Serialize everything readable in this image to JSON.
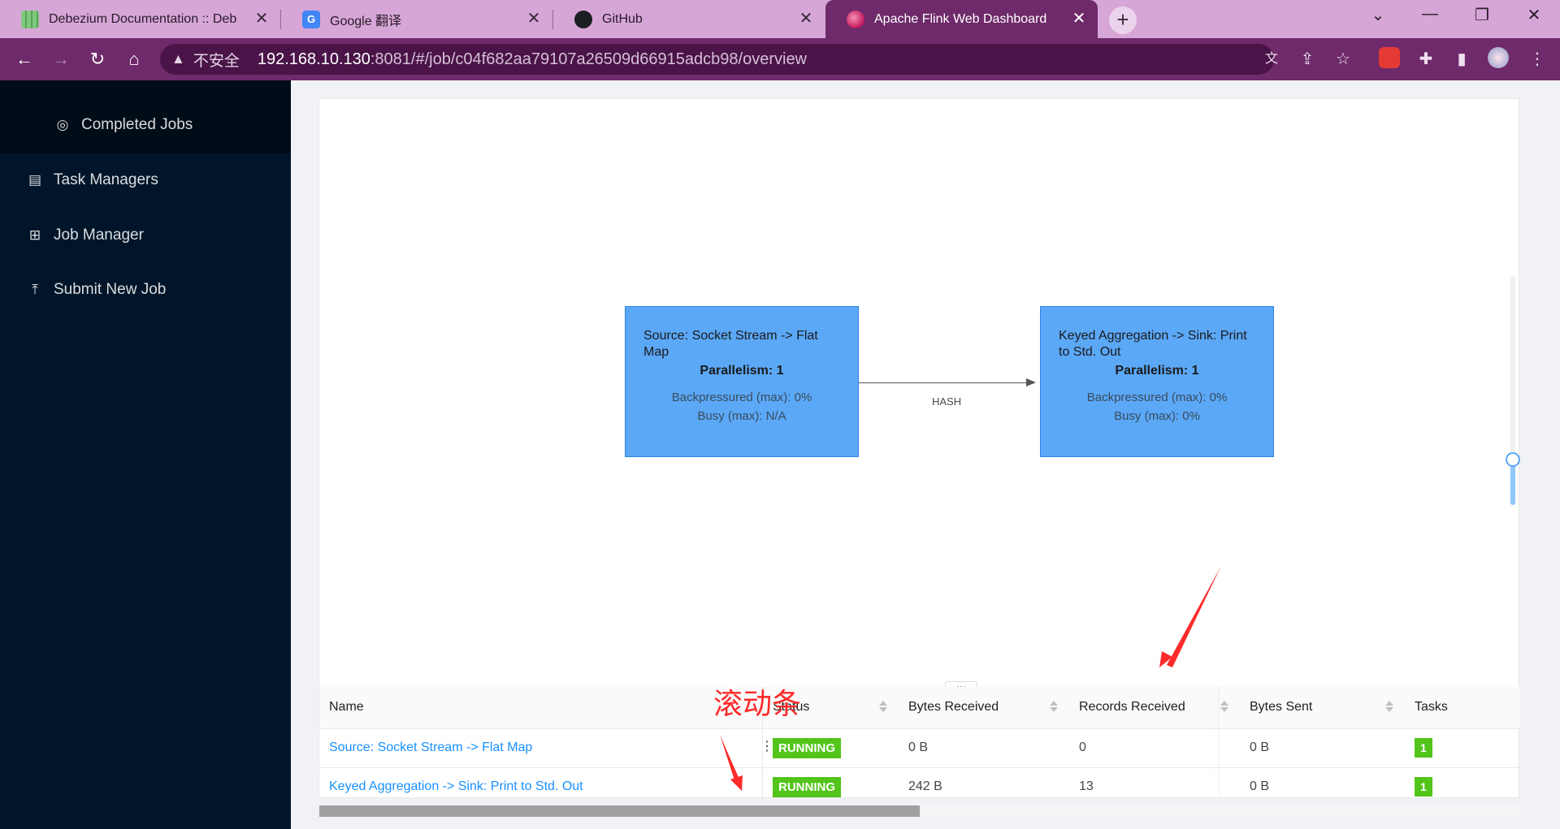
{
  "browser": {
    "tabs": [
      {
        "label": "Debezium Documentation :: Deb",
        "icon": "debezium-favicon",
        "active": false
      },
      {
        "label": "Google 翻译",
        "icon": "google-translate-favicon",
        "active": false
      },
      {
        "label": "GitHub",
        "icon": "github-favicon",
        "active": false
      },
      {
        "label": "Apache Flink Web Dashboard",
        "icon": "flink-favicon",
        "active": true
      }
    ],
    "close_glyph": "✕",
    "new_tab_glyph": "+",
    "insecure_label": "不安全",
    "url_host": "192.168.10.130",
    "url_path": ":8081/#/job/c04f682aa79107a26509d66915adcb98/overview",
    "colors": {
      "tabbar": "#d6a6d6",
      "toolbar": "#6e2a6a"
    }
  },
  "sidebar": {
    "completed_jobs": "Completed Jobs",
    "task_managers": "Task Managers",
    "job_manager": "Job Manager",
    "submit_new_job": "Submit New Job"
  },
  "graph": {
    "nodes": [
      {
        "title": "Source: Socket Stream -> Flat Map",
        "parallelism": "Parallelism: 1",
        "backpressured": "Backpressured (max): 0%",
        "busy": "Busy (max): N/A"
      },
      {
        "title": "Keyed Aggregation -> Sink: Print to Std. Out",
        "parallelism": "Parallelism: 1",
        "backpressured": "Backpressured (max): 0%",
        "busy": "Busy (max): 0%"
      }
    ],
    "edge_label": "HASH",
    "node_color": "#5ba8f7",
    "zoom_level_fraction": 0.2
  },
  "table": {
    "resizer_glyph": "···",
    "columns": [
      "Name",
      "Status",
      "Bytes Received",
      "Records Received",
      "Bytes Sent",
      "Tasks"
    ],
    "rows": [
      {
        "name": "Source: Socket Stream -> Flat Map",
        "status": "RUNNING",
        "bytes_received": "0 B",
        "records_received": "0",
        "bytes_sent": "0 B",
        "tasks": "1"
      },
      {
        "name": "Keyed Aggregation -> Sink: Print to Std. Out",
        "status": "RUNNING",
        "bytes_received": "242 B",
        "records_received": "13",
        "bytes_sent": "0 B",
        "tasks": "1"
      }
    ],
    "status_color": "#52c41a",
    "horizontal_scroll_fraction": 0.5
  },
  "annotation": {
    "text": "滚动条",
    "color": "#ff2a2a"
  }
}
